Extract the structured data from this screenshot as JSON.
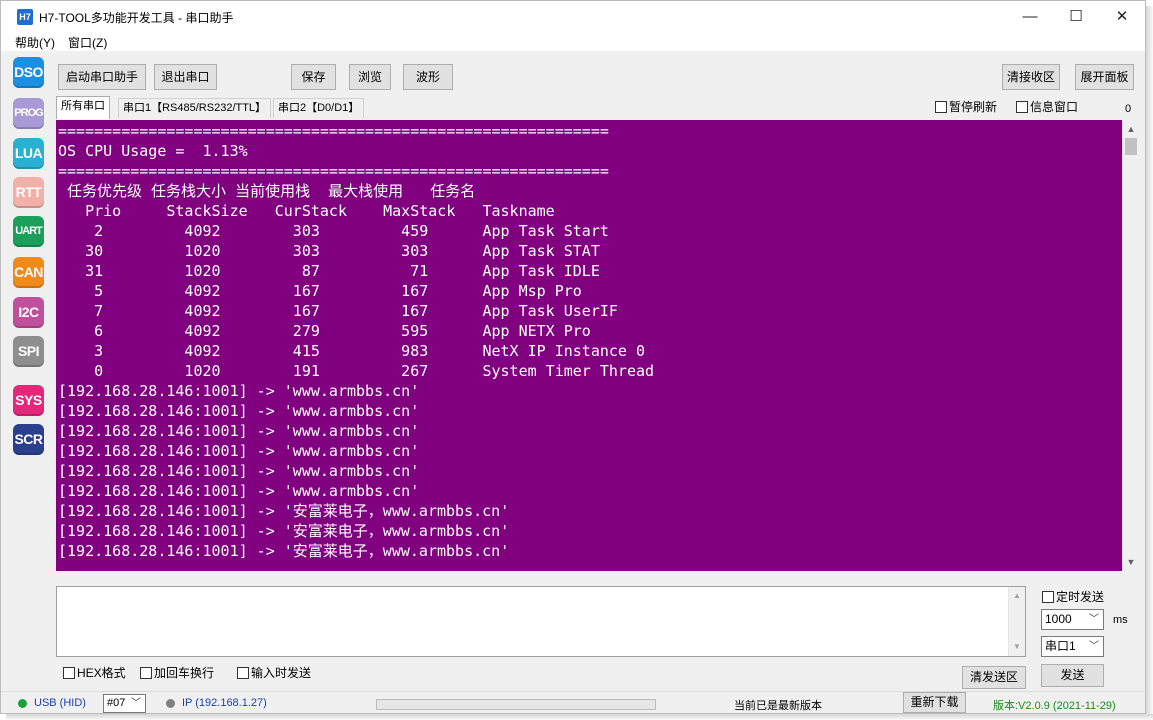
{
  "window": {
    "app_icon": "H7",
    "title": "H7-TOOL多功能开发工具 - 串口助手",
    "minimize": "—",
    "maximize": "☐",
    "close": "✕"
  },
  "menu": [
    "帮助(Y)",
    "窗口(Z)"
  ],
  "sidebar": [
    {
      "label": "DSO",
      "color": "#1c8fe0"
    },
    {
      "label": "PROG",
      "color": "#a79ad6"
    },
    {
      "label": "LUA",
      "color": "#2ab0d2"
    },
    {
      "label": "RTT",
      "color": "#f3b0a8"
    },
    {
      "label": "UART",
      "color": "#1aa05a"
    },
    {
      "label": "CAN",
      "color": "#f08a1a"
    },
    {
      "label": "I2C",
      "color": "#c0509e"
    },
    {
      "label": "SPI",
      "color": "#8e8e8e"
    },
    {
      "label": "SYS",
      "color": "#e3287a"
    },
    {
      "label": "SCR",
      "color": "#2b3f8f"
    }
  ],
  "toolbar": {
    "start": "启动串口助手",
    "exit": "退出串口",
    "save": "保存",
    "browse": "浏览",
    "wave": "波形",
    "clear_recv": "清接收区",
    "expand": "展开面板"
  },
  "tabs": [
    "所有串口",
    "串口1【RS485/RS232/TTL】",
    "串口2【D0/D1】"
  ],
  "options": {
    "pause_refresh": "暂停刷新",
    "info_window": "信息窗口",
    "counter": "0"
  },
  "terminal_lines": [
    "=============================================================",
    "OS CPU Usage =  1.13%",
    "=============================================================",
    " 任务优先级 任务栈大小 当前使用栈  最大栈使用   任务名",
    "   Prio     StackSize   CurStack    MaxStack   Taskname",
    "    2         4092        303         459      App Task Start",
    "   30         1020        303         303      App Task STAT",
    "   31         1020         87          71      App Task IDLE",
    "    5         4092        167         167      App Msp Pro",
    "    7         4092        167         167      App Task UserIF",
    "    6         4092        279         595      App NETX Pro",
    "    3         4092        415         983      NetX IP Instance 0",
    "    0         1020        191         267      System Timer Thread",
    "[192.168.28.146:1001] -> 'www.armbbs.cn'",
    "[192.168.28.146:1001] -> 'www.armbbs.cn'",
    "[192.168.28.146:1001] -> 'www.armbbs.cn'",
    "[192.168.28.146:1001] -> 'www.armbbs.cn'",
    "[192.168.28.146:1001] -> 'www.armbbs.cn'",
    "[192.168.28.146:1001] -> 'www.armbbs.cn'",
    "[192.168.28.146:1001] -> '安富莱电子，www.armbbs.cn'",
    "[192.168.28.146:1001] -> '安富莱电子，www.armbbs.cn'",
    "[192.168.28.146:1001] -> '安富莱电子，www.armbbs.cn'"
  ],
  "send": {
    "timed_send": "定时发送",
    "interval": "1000",
    "ms": "ms",
    "port": "串口1",
    "hex": "HEX格式",
    "crlf": "加回车换行",
    "send_on_input": "输入时发送",
    "clear_send": "清发送区",
    "send_btn": "发送"
  },
  "status": {
    "usb": "USB (HID)",
    "device": "#07",
    "ip": "IP (192.168.1.27)",
    "update_msg": "当前已是最新版本",
    "redownload": "重新下载",
    "version": "版本:V2.0.9 (2021-11-29)",
    "usb_color": "#1aa03a",
    "ip_color": "#808080",
    "version_color": "#1a8a1a"
  }
}
